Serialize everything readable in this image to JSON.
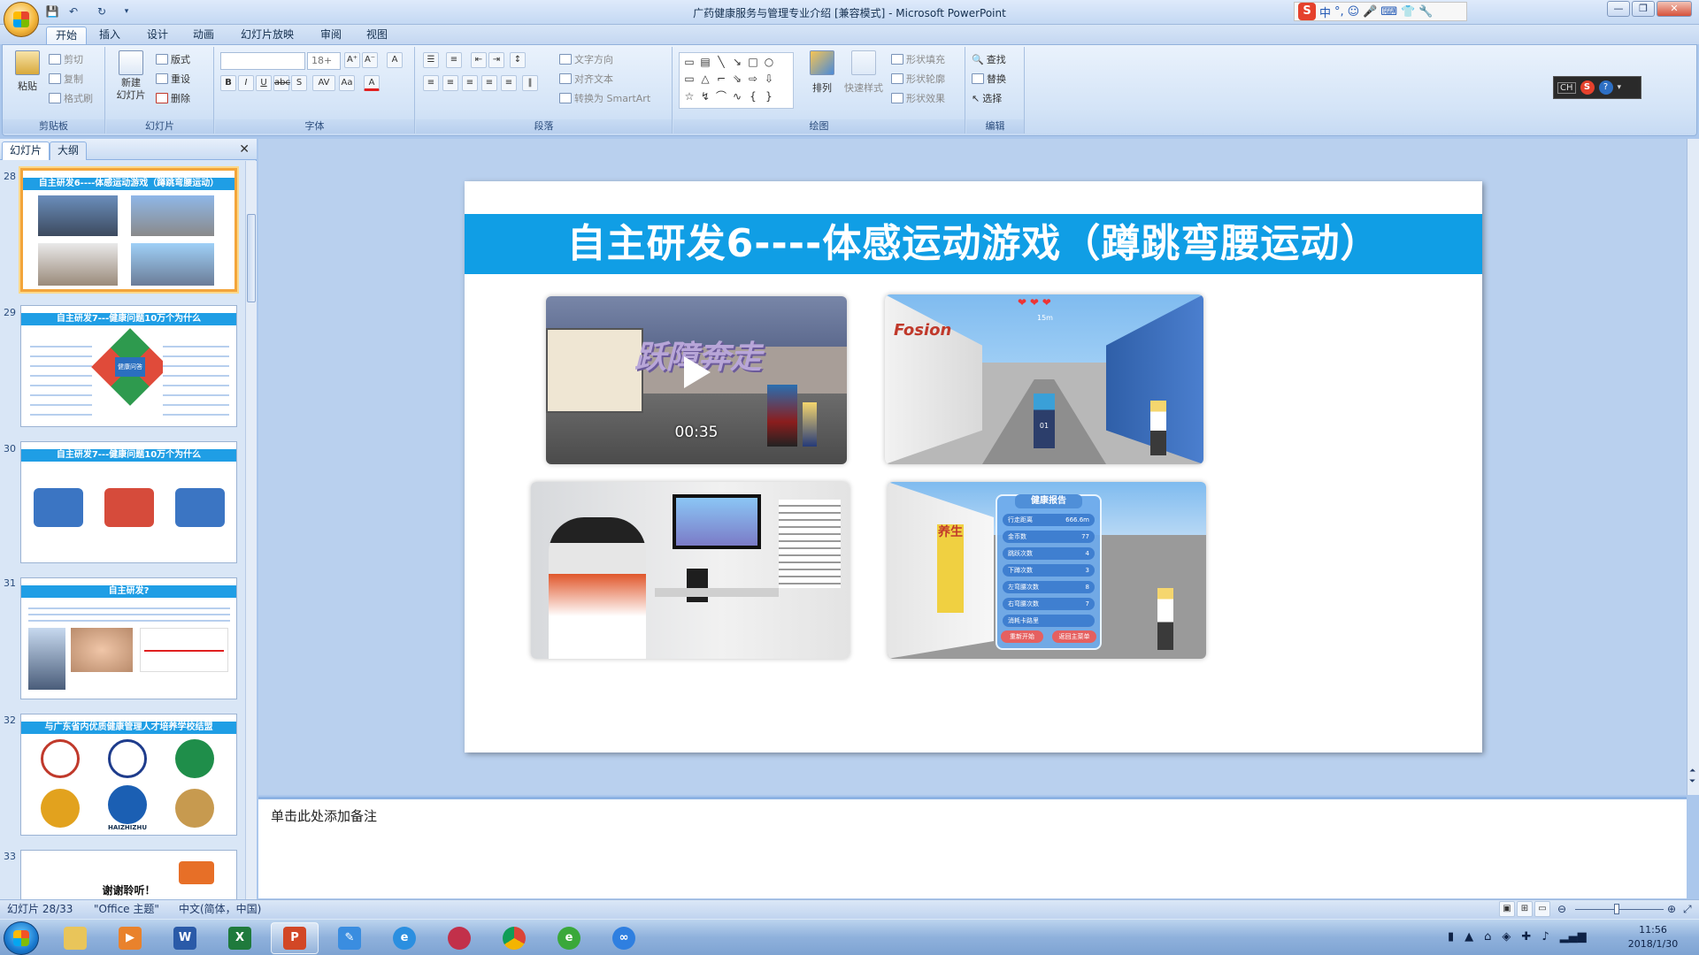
{
  "window": {
    "title": "广药健康服务与管理专业介绍 [兼容模式] - Microsoft PowerPoint"
  },
  "tabs": [
    "开始",
    "插入",
    "设计",
    "动画",
    "幻灯片放映",
    "审阅",
    "视图"
  ],
  "ribbon": {
    "clipboard": {
      "label": "剪贴板",
      "paste": "粘贴",
      "cut": "剪切",
      "copy": "复制",
      "format_painter": "格式刷"
    },
    "slides": {
      "label": "幻灯片",
      "new_slide": "新建\n幻灯片",
      "layout": "版式",
      "reset": "重设",
      "delete": "删除"
    },
    "font": {
      "label": "字体",
      "font_size": "18+"
    },
    "paragraph": {
      "label": "段落",
      "text_direction": "文字方向",
      "align_text": "对齐文本",
      "smartart": "转换为 SmartArt"
    },
    "drawing": {
      "label": "绘图",
      "arrange": "排列",
      "quick_styles": "快速样式",
      "shape_fill": "形状填充",
      "shape_outline": "形状轮廓",
      "shape_effects": "形状效果"
    },
    "editing": {
      "label": "编辑",
      "find": "查找",
      "replace": "替换",
      "select": "选择"
    }
  },
  "ime": {
    "lang": "中"
  },
  "langbar": {
    "lang": "CH"
  },
  "panel": {
    "tab_slides": "幻灯片",
    "tab_outline": "大纲"
  },
  "thumbnails": [
    {
      "num": "28",
      "title": "自主研发6----体感运动游戏（蹲跳弯腰运动）"
    },
    {
      "num": "29",
      "title": "自主研发7---健康问题10万个为什么"
    },
    {
      "num": "30",
      "title": "自主研发7---健康问题10万个为什么"
    },
    {
      "num": "31",
      "title": "自主研发?"
    },
    {
      "num": "32",
      "title": "与广东省内优质健康管理人才培养学校结盟"
    },
    {
      "num": "33",
      "title": "谢谢聆听！"
    }
  ],
  "thumb29": {
    "center": "健康问答"
  },
  "thumb32": {
    "logo_text": "HAIZHIZHU"
  },
  "slide": {
    "title": "自主研发6----体感运动游戏（蹲跳弯腰运动）",
    "video": {
      "time": "00:35",
      "game_title": "跃障奔走"
    },
    "game2": {
      "distance": "15m",
      "shop": "Fosion",
      "jersey": "01"
    },
    "report": {
      "title": "健康报告",
      "rows": [
        {
          "label": "行走距离",
          "value": "666.6m"
        },
        {
          "label": "金币数",
          "value": "77"
        },
        {
          "label": "跳跃次数",
          "value": "4"
        },
        {
          "label": "下蹲次数",
          "value": "3"
        },
        {
          "label": "左弯腰次数",
          "value": "8"
        },
        {
          "label": "右弯腰次数",
          "value": "7"
        },
        {
          "label": "消耗卡路里",
          "value": ""
        }
      ],
      "restart": "重新开始",
      "back": "返回主菜单"
    },
    "sign": "养生"
  },
  "notes": {
    "placeholder": "单击此处添加备注"
  },
  "status": {
    "slide_pos": "幻灯片 28/33",
    "theme": "\"Office 主题\"",
    "lang": "中文(简体，中国)"
  },
  "clock": {
    "time": "11:56",
    "date": "2018/1/30"
  }
}
